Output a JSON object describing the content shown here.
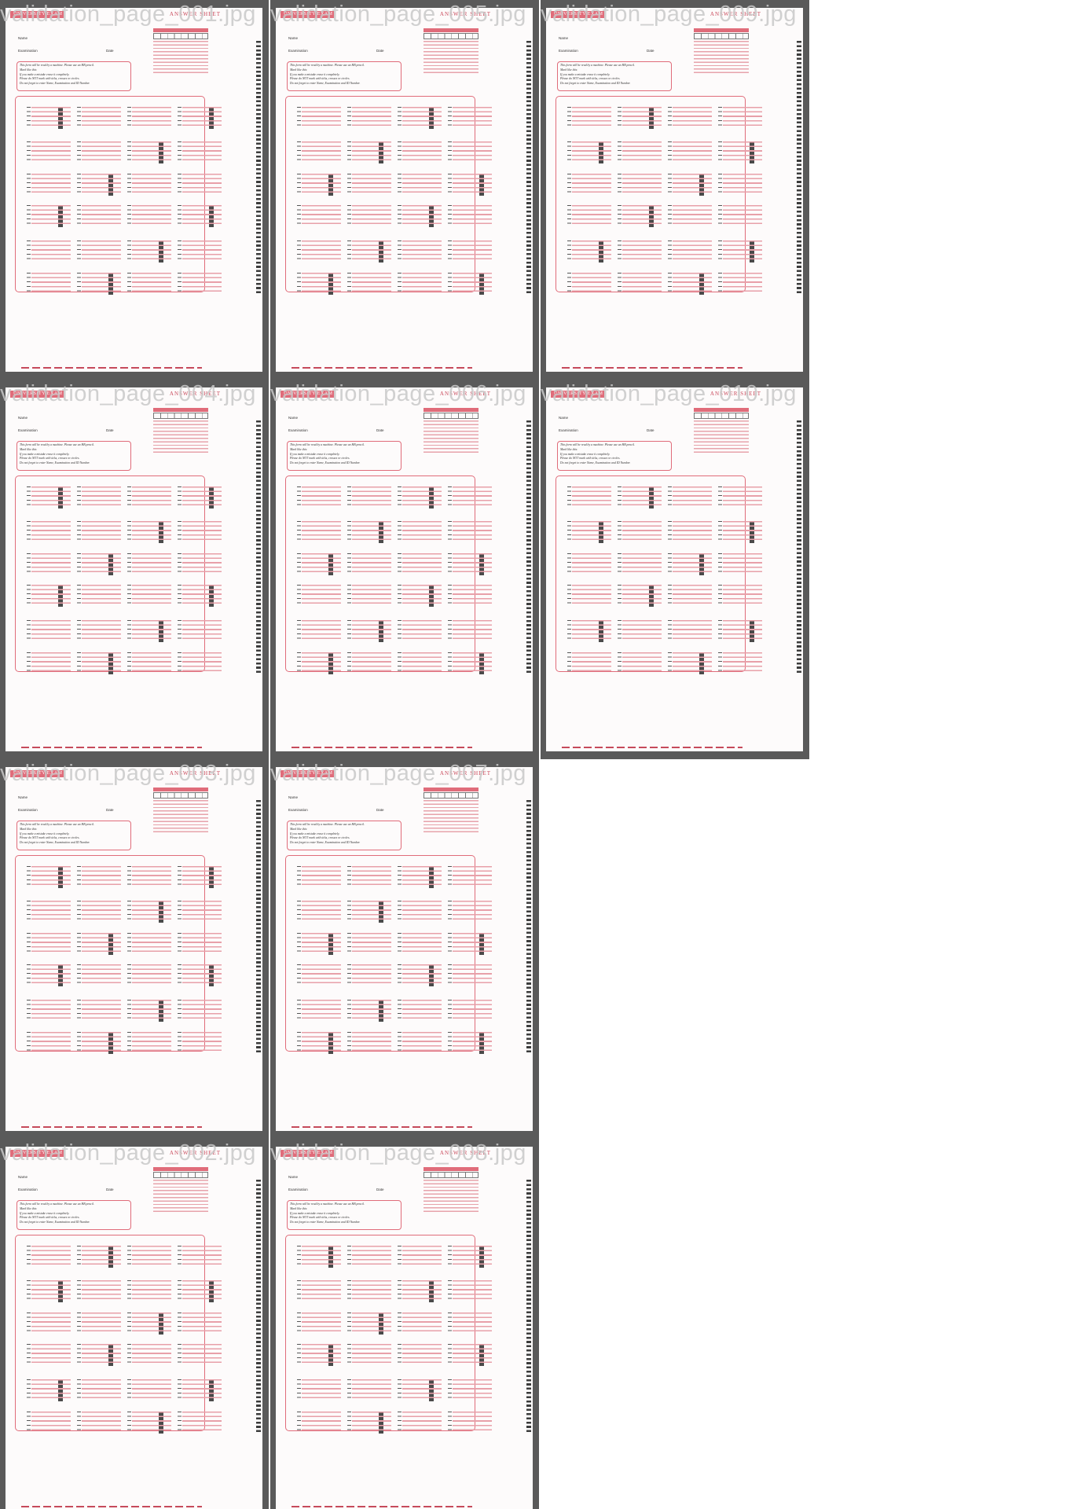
{
  "tiles": [
    {
      "caption": "validation_page_001.jpg"
    },
    {
      "caption": "validation_page_005.jpg"
    },
    {
      "caption": "validation_page_009.jpg"
    },
    {
      "caption": "validation_page_004.jpg"
    },
    {
      "caption": "validation_page_006.jpg"
    },
    {
      "caption": "validation_page_010.jpg"
    },
    {
      "caption": "validation_page_003.jpg"
    },
    {
      "caption": "validation_page_007.jpg"
    },
    {
      "caption": "validation_page_002.jpg"
    },
    {
      "caption": "validation_page_008.jpg"
    }
  ],
  "sheet": {
    "brand": "UNIVERSITY EXAM",
    "title": "ANSWER SHEET",
    "name_label": "Name",
    "exam_label": "Examination",
    "date_label": "Date",
    "id_label": "STUDENT ID NUMBER",
    "instructions": [
      "This form will be read by a machine.  Please use an HB pencil.",
      "Mark like this:",
      "If you make a mistake erase it completely.",
      "Please do NOT mark with ticks, crosses or circles.",
      "Do not forget to enter Name, Examination and ID Number."
    ]
  },
  "colors": {
    "frame": "#5a5a5a",
    "accent": "#e06c7a",
    "caption": "#c8c8c8"
  }
}
